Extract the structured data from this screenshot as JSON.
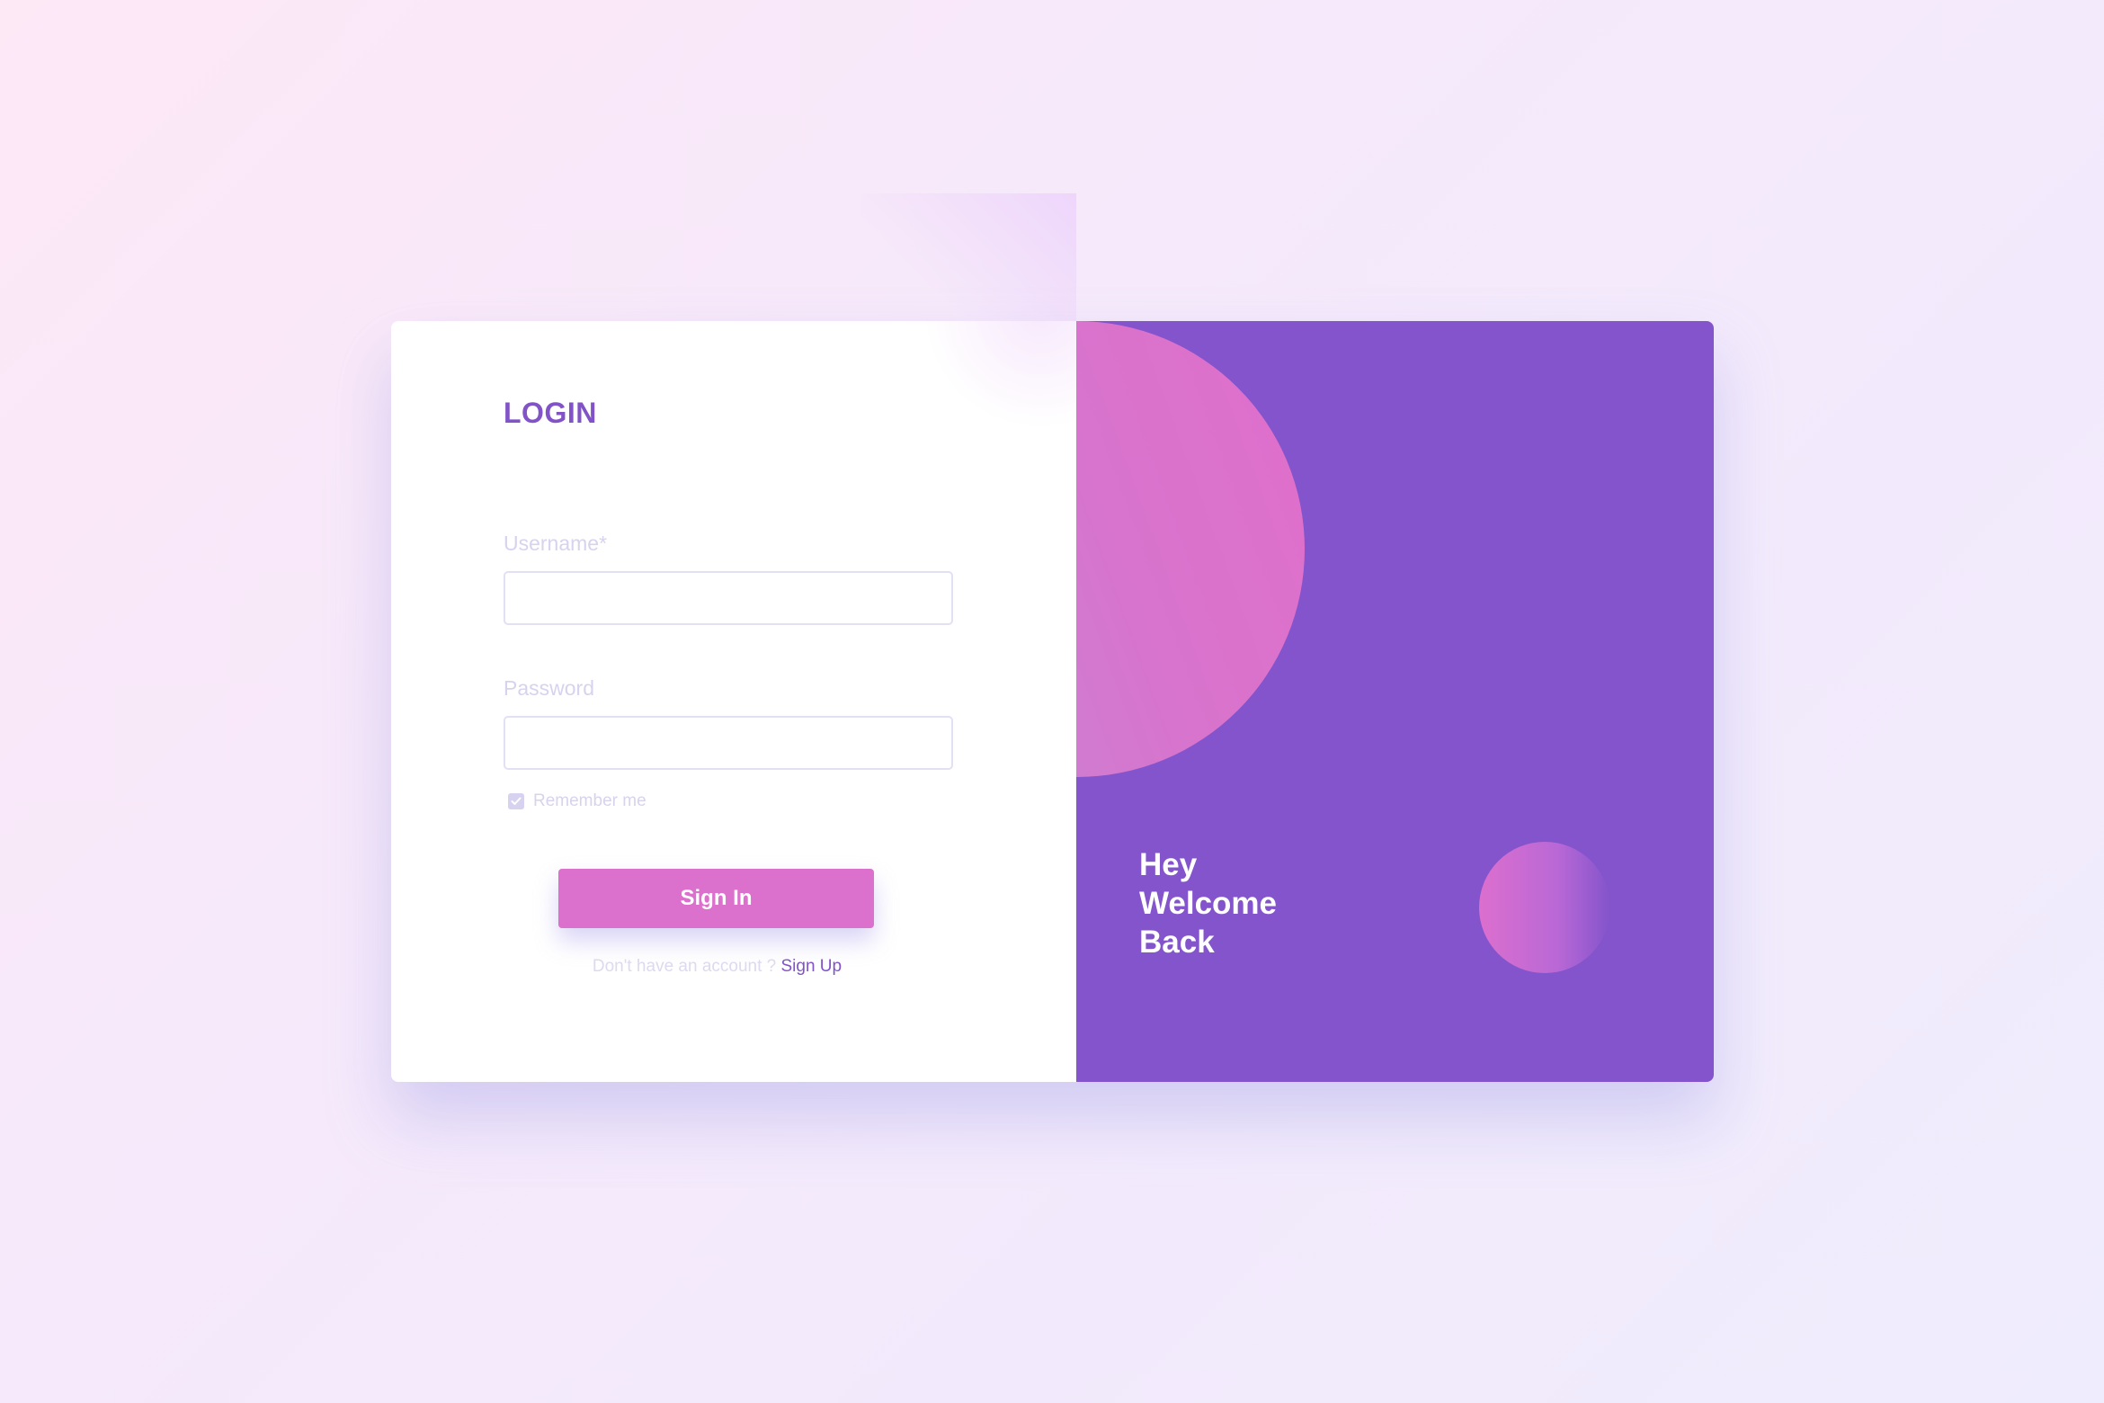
{
  "login": {
    "title": "LOGIN",
    "username_label": "Username*",
    "username_value": "",
    "password_label": "Password",
    "password_value": "",
    "remember_label": "Remember me",
    "remember_checked": true,
    "signin_label": "Sign In",
    "signup_prompt": "Don't have an account ?",
    "signup_link": "Sign Up"
  },
  "welcome": {
    "line1": "Hey",
    "line2": "Welcome",
    "line3": "Back"
  },
  "colors": {
    "accent": "#8153c7",
    "button": "#db71cd",
    "panel": "#8354cb"
  }
}
